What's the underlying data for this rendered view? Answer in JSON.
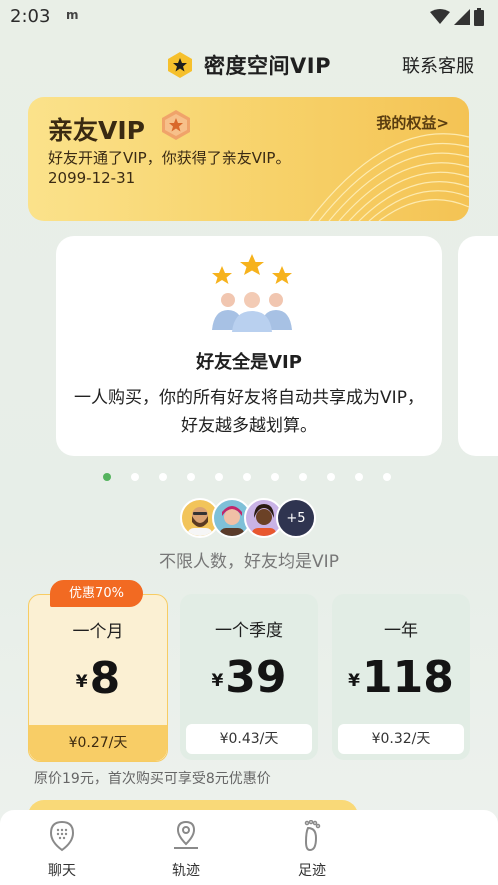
{
  "status": {
    "time": "2:03",
    "notif": "m"
  },
  "header": {
    "title": "密度空间VIP",
    "service": "联系客服"
  },
  "vip_card": {
    "title": "亲友VIP",
    "rights": "我的权益>",
    "desc": "好友开通了VIP，你获得了亲友VIP。",
    "date": "2099-12-31"
  },
  "feature": {
    "title": "好友全是VIP",
    "desc": "一人购买，你的所有好友将自动共享成为VIP，好友越多越划算。"
  },
  "pager": {
    "count": 11,
    "active": 0
  },
  "avatars": {
    "more": "+5",
    "caption": "不限人数，好友均是VIP"
  },
  "plans": [
    {
      "name": "一个月",
      "currency": "¥",
      "price": "8",
      "daily": "¥0.27/天",
      "selected": true
    },
    {
      "name": "一个季度",
      "currency": "¥",
      "price": "39",
      "daily": "¥0.43/天",
      "selected": false
    },
    {
      "name": "一年",
      "currency": "¥",
      "price": "118",
      "daily": "¥0.32/天",
      "selected": false
    }
  ],
  "discount_badge": "优惠70%",
  "original_price_note": "原价19元，首次购买可享受8元优惠价",
  "tabs": [
    {
      "label": "聊天",
      "icon": "chat-bubble-icon"
    },
    {
      "label": "轨迹",
      "icon": "map-pin-icon"
    },
    {
      "label": "足迹",
      "icon": "footprint-icon"
    }
  ],
  "colors": {
    "accent_gold": "#f7d26a",
    "discount_orange": "#f26a22",
    "active_dot": "#55b35e"
  }
}
